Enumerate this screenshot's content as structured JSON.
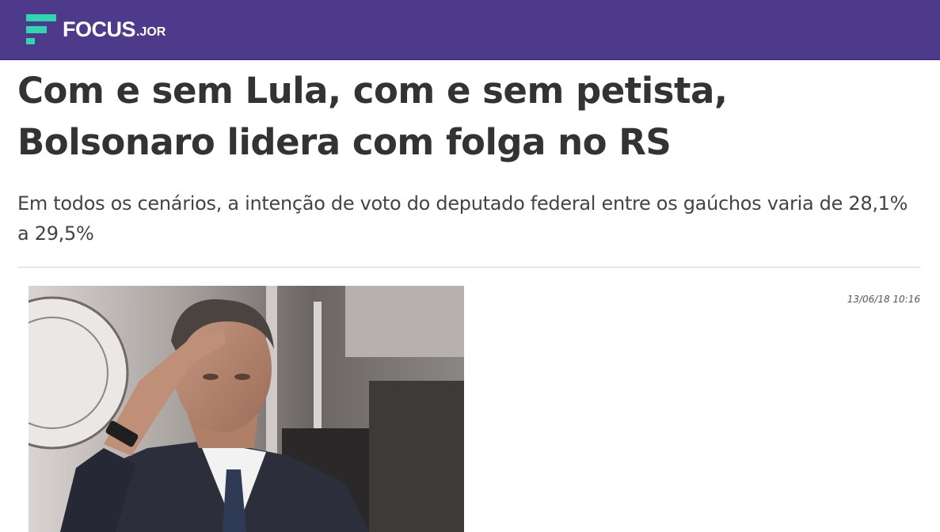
{
  "header": {
    "logo_text": "FOCUS",
    "logo_suffix": ".JOR",
    "logo_icon": "focus-f-logo-icon",
    "background_color": "#4e3a8b",
    "accent_color": "#2fd6b0"
  },
  "article": {
    "title": "Com e sem Lula, com e sem petista, Bolsonaro lidera com folga no RS",
    "subtitle": "Em todos os cenários, a intenção de voto do deputado federal entre os gaúchos varia de 28,1% a 29,5%",
    "timestamp": "13/06/18 10:16",
    "image_alt": "Bolsonaro prestando continência"
  }
}
